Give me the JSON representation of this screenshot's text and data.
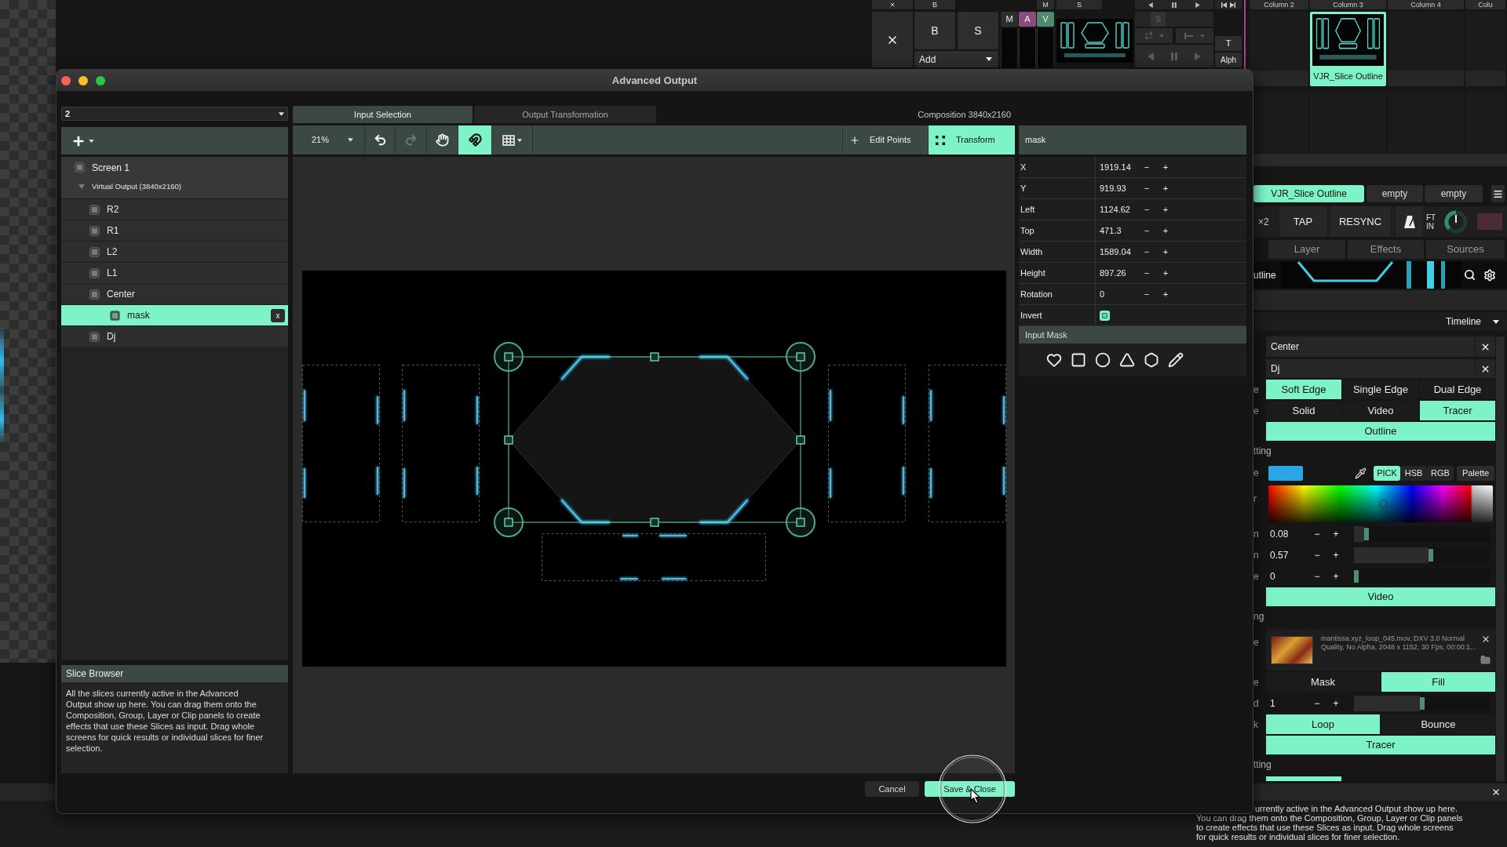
{
  "background": {
    "layer_strip": {
      "cut_row": {
        "blend": "B",
        "mute": "M",
        "solo": "S"
      },
      "blend_buttons": [
        "B",
        "S"
      ],
      "blend_mode": "Add",
      "toggles": [
        {
          "label": "M",
          "on": false
        },
        {
          "label": "A",
          "on": true,
          "color": "#8b4b7d"
        },
        {
          "label": "V",
          "on": true,
          "color": "#4c8a6b"
        }
      ],
      "solo": {
        "label": "S",
        "disabled": true
      },
      "text_button": "T",
      "alpha_button": "Alph"
    },
    "clip_grid": {
      "columns": [
        {
          "header": "Column 2"
        },
        {
          "header": "Column 3",
          "clip": {
            "name": "VJR_Slice Outline",
            "selected": true
          }
        },
        {
          "header": "Column 4"
        },
        {
          "header": "Colu"
        }
      ]
    },
    "deck_tabs": [
      {
        "label": "VJR_Slice Outline",
        "selected": true
      },
      {
        "label": "empty",
        "selected": false
      },
      {
        "label": "empty",
        "selected": false
      }
    ],
    "tempo": {
      "multiplier": "×2",
      "tap": "TAP",
      "resync": "RESYNC",
      "fade": [
        "FT",
        "IN"
      ]
    },
    "panel_tabs": [
      {
        "label": "Layer",
        "selected": false
      },
      {
        "label": "Effects",
        "selected": false
      },
      {
        "label": "Sources",
        "selected": false
      }
    ],
    "clip_preview": {
      "name": "utline"
    },
    "timeline": {
      "label": "Timeline"
    },
    "slice_inputs": [
      {
        "name": "Center"
      },
      {
        "name": "Dj"
      }
    ],
    "settings": [
      {
        "kind": "segmented",
        "label": "e",
        "options": [
          {
            "label": "Soft Edge",
            "selected": true
          },
          {
            "label": "Single Edge",
            "selected": false
          },
          {
            "label": "Dual Edge",
            "selected": false
          }
        ]
      },
      {
        "kind": "segmented",
        "label": "e",
        "options": [
          {
            "label": "Solid",
            "selected": false
          },
          {
            "label": "Video",
            "selected": false
          },
          {
            "label": "Tracer",
            "selected": true
          }
        ]
      },
      {
        "kind": "bar",
        "label": "Outline"
      },
      {
        "kind": "heading",
        "label": "tting"
      },
      {
        "kind": "color",
        "label": "e",
        "color": "#2ba6e6",
        "modes": [
          {
            "label": "PICK",
            "selected": true
          },
          {
            "label": "HSB",
            "selected": false
          },
          {
            "label": "RGB",
            "selected": false
          }
        ],
        "palette": "Palette"
      },
      {
        "kind": "spectrum",
        "label": "r"
      },
      {
        "kind": "slider",
        "label": "n",
        "value": "0.08",
        "minus": "−",
        "plus": "+",
        "level": 0.08
      },
      {
        "kind": "slider",
        "label": "n",
        "value": "0.57",
        "minus": "−",
        "plus": "+",
        "level": 0.57
      },
      {
        "kind": "slider",
        "label": "e",
        "value": "0",
        "minus": "−",
        "plus": "+",
        "level": 0
      },
      {
        "kind": "bar",
        "label": "Video"
      },
      {
        "kind": "heading",
        "label": "ng"
      },
      {
        "kind": "media",
        "label": "e",
        "info": "mantissa.xyz_loop_045.mov, DXV 3.0 Normal Quality, No Alpha, 2048 x 1152, 30 Fps, 00:00:1..."
      },
      {
        "kind": "segmented",
        "label": "e",
        "options": [
          {
            "label": "Mask",
            "selected": false
          },
          {
            "label": "Fill",
            "selected": true
          }
        ]
      },
      {
        "kind": "slider",
        "label": "d",
        "value": "1",
        "minus": "−",
        "plus": "+",
        "level": 0.5
      },
      {
        "kind": "segmented",
        "label": "k",
        "options": [
          {
            "label": "Loop",
            "selected": true
          },
          {
            "label": "Bounce",
            "selected": false
          }
        ]
      },
      {
        "kind": "bar",
        "label": "Tracer"
      },
      {
        "kind": "heading",
        "label": "tting"
      },
      {
        "kind": "partial_bar"
      }
    ],
    "info_panel": {
      "lines": [
        "urrently active in the Advanced Output show up here.",
        "You can drag them onto the Composition, Group, Layer or Clip panels",
        "to create effects that use these Slices as input. Drag whole screens",
        "for quick results or individual slices for finer selection."
      ]
    }
  },
  "dialog": {
    "title": "Advanced Output",
    "screen_select": "2",
    "tree": {
      "delete_label": "x",
      "screens": [
        {
          "name": "Screen 1",
          "selected": false,
          "output": "Virtual Output (3840x2160)",
          "expanded": true,
          "children": [
            {
              "name": "R2",
              "selected": false
            },
            {
              "name": "R1",
              "selected": false
            },
            {
              "name": "L2",
              "selected": false
            },
            {
              "name": "L1",
              "selected": false
            },
            {
              "name": "Center",
              "selected": false,
              "children": [
                {
                  "name": "mask",
                  "selected": true
                }
              ]
            },
            {
              "name": "Dj",
              "selected": false
            }
          ]
        }
      ]
    },
    "slice_browser": {
      "title": "Slice Browser",
      "text": "All the slices currently active in the Advanced Output show up here. You can drag them onto the Composition, Group, Layer or Clip panels to create effects that use these Slices as input. Drag whole screens for quick results or individual slices for finer selection."
    },
    "tabs": [
      {
        "label": "Input Selection",
        "selected": true
      },
      {
        "label": "Output Transformation",
        "selected": false
      }
    ],
    "composition": "Composition 3840x2160",
    "toolbar": {
      "zoom": "21%",
      "tools": [
        {
          "kind": "undo",
          "disabled": false
        },
        {
          "kind": "redo",
          "disabled": true
        },
        {
          "kind": "hand",
          "active": false
        },
        {
          "kind": "magnet",
          "active": true
        },
        {
          "kind": "grid",
          "active": false
        }
      ],
      "modes": [
        {
          "kind": "edit_points",
          "label": "Edit Points",
          "selected": false
        },
        {
          "kind": "transform",
          "label": "Transform",
          "selected": true
        }
      ]
    },
    "properties": {
      "title": "mask",
      "rows": [
        {
          "kind": "number",
          "label": "X",
          "value": "1919.14",
          "minus": "−",
          "plus": "+"
        },
        {
          "kind": "number",
          "label": "Y",
          "value": "919.93",
          "minus": "−",
          "plus": "+"
        },
        {
          "kind": "number",
          "label": "Left",
          "value": "1124.62",
          "minus": "−",
          "plus": "+"
        },
        {
          "kind": "number",
          "label": "Top",
          "value": "471.3",
          "minus": "−",
          "plus": "+"
        },
        {
          "kind": "number",
          "label": "Width",
          "value": "1589.04",
          "minus": "−",
          "plus": "+"
        },
        {
          "kind": "number",
          "label": "Height",
          "value": "897.26",
          "minus": "−",
          "plus": "+"
        },
        {
          "kind": "number",
          "label": "Rotation",
          "value": "0",
          "minus": "−",
          "plus": "+"
        },
        {
          "kind": "checkbox",
          "label": "Invert",
          "checked": true
        }
      ],
      "mask_section": "Input Mask"
    },
    "buttons": [
      {
        "label": "Cancel",
        "primary": false
      },
      {
        "label": "Save & Close",
        "primary": true
      }
    ]
  }
}
